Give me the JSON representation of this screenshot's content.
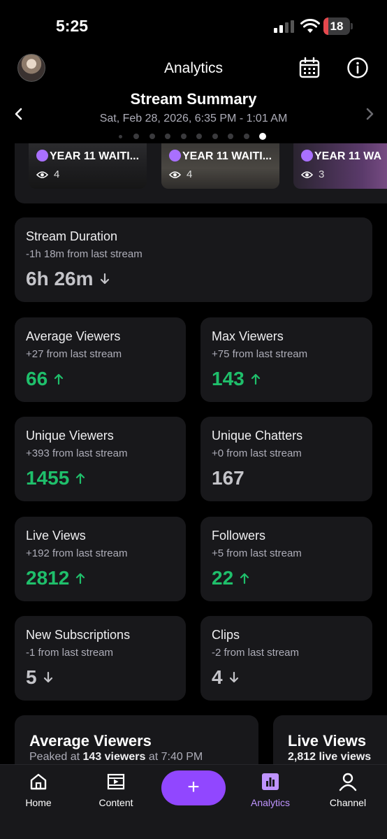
{
  "status_bar": {
    "time": "5:25",
    "battery": "18",
    "battery_level": 0.18
  },
  "header": {
    "title": "Analytics"
  },
  "summary": {
    "title": "Stream Summary",
    "date": "Sat, Feb 28, 2026, 6:35 PM - 1:01 AM",
    "dot_count": 10,
    "active_dot": 10
  },
  "clips": [
    {
      "title": "YEAR 11 WAITI...",
      "views": "4"
    },
    {
      "title": "YEAR 11 WAITI...",
      "views": "4"
    },
    {
      "title": "YEAR 11 WA",
      "views": "3"
    }
  ],
  "stats": {
    "stream_duration": {
      "label": "Stream Duration",
      "sub": "-1h 18m from last stream",
      "value": "6h 26m",
      "trend": "down"
    },
    "average_viewers": {
      "label": "Average Viewers",
      "sub": "+27 from last stream",
      "value": "66",
      "trend": "up"
    },
    "max_viewers": {
      "label": "Max Viewers",
      "sub": "+75 from last stream",
      "value": "143",
      "trend": "up"
    },
    "unique_viewers": {
      "label": "Unique Viewers",
      "sub": "+393 from last stream",
      "value": "1455",
      "trend": "up"
    },
    "unique_chatters": {
      "label": "Unique Chatters",
      "sub": "+0 from last stream",
      "value": "167",
      "trend": "flat"
    },
    "live_views": {
      "label": "Live Views",
      "sub": "+192 from last stream",
      "value": "2812",
      "trend": "up"
    },
    "followers": {
      "label": "Followers",
      "sub": "+5 from last stream",
      "value": "22",
      "trend": "up"
    },
    "new_subscriptions": {
      "label": "New Subscriptions",
      "sub": "-1 from last stream",
      "value": "5",
      "trend": "down"
    },
    "clips": {
      "label": "Clips",
      "sub": "-2 from last stream",
      "value": "4",
      "trend": "down"
    }
  },
  "detail_cards": {
    "average_viewers": {
      "title": "Average Viewers",
      "sub_prefix": "Peaked at",
      "sub_value": "143 viewers",
      "sub_mid": "at 7:40 PM"
    },
    "live_views": {
      "title": "Live Views",
      "sub_value": "2,812 live views"
    }
  },
  "bottom_nav": {
    "home": "Home",
    "content": "Content",
    "create": "+",
    "analytics": "Analytics",
    "channel": "Channel"
  },
  "colors": {
    "accent": "#9147ff",
    "up": "#1fbf6b",
    "card": "#18181b",
    "active_nav": "#bf94ff"
  }
}
